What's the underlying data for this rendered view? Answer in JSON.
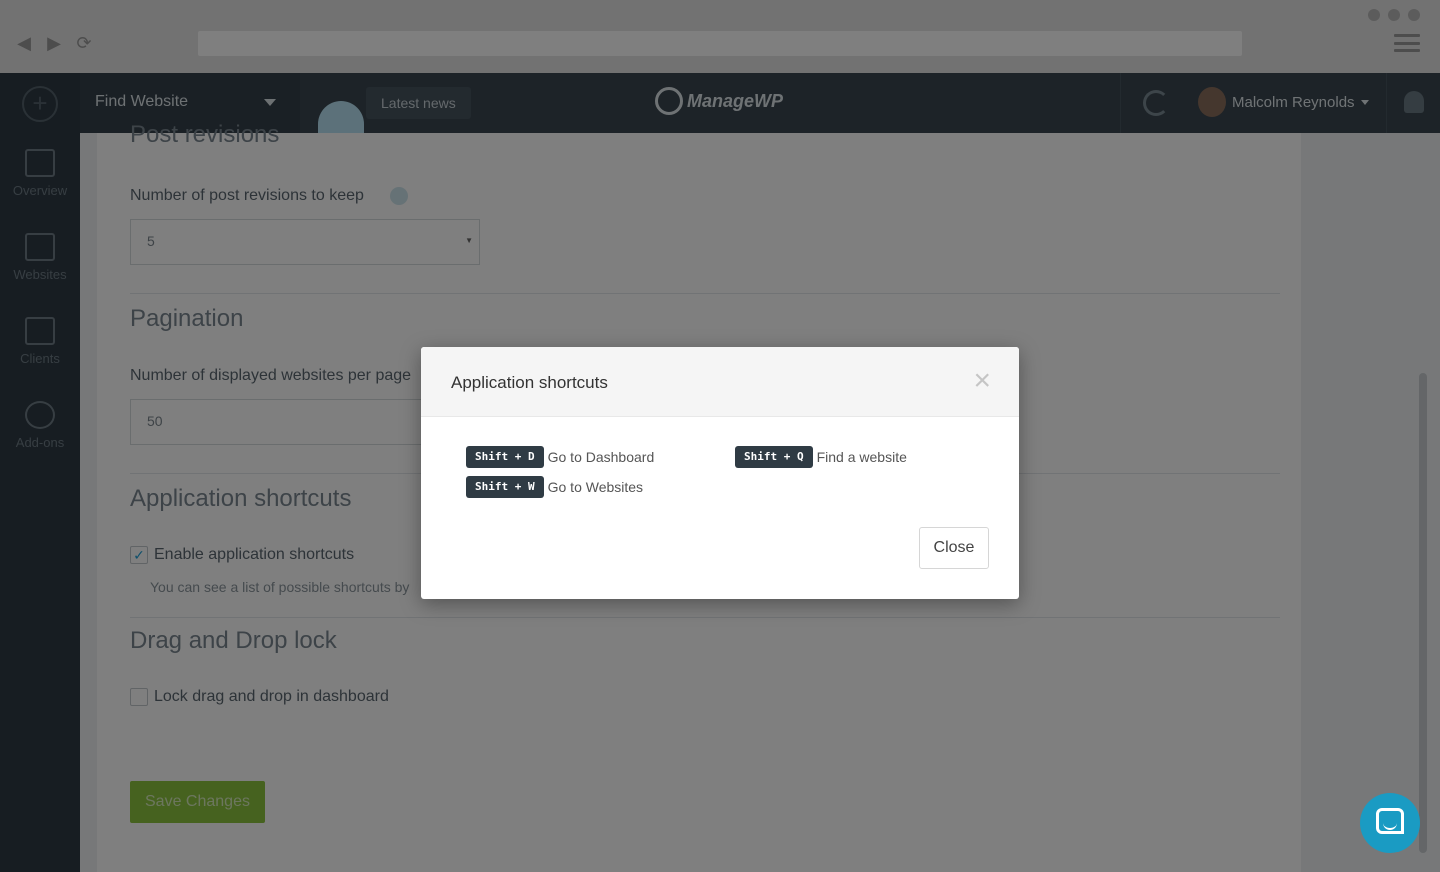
{
  "browser": {
    "back_icon": "◀",
    "forward_icon": "▶",
    "reload_icon": "⟳"
  },
  "sidebar": {
    "items": [
      {
        "label": "Overview",
        "icon": "chart-icon"
      },
      {
        "label": "Websites",
        "icon": "websites-icon"
      },
      {
        "label": "Clients",
        "icon": "clients-icon"
      },
      {
        "label": "Add-ons",
        "icon": "gear-icon"
      }
    ]
  },
  "topbar": {
    "find_label": "Find Website",
    "news_label": "Latest news",
    "logo_text": "ManageWP",
    "user_name": "Malcolm Reynolds"
  },
  "settings": {
    "post_revisions_heading": "Post revisions",
    "post_revisions_label": "Number of post revisions to keep",
    "post_revisions_value": "5",
    "pagination_heading": "Pagination",
    "pagination_label": "Number of displayed websites per page",
    "pagination_value": "50",
    "shortcuts_heading": "Application shortcuts",
    "shortcuts_checkbox_label": "Enable application shortcuts",
    "shortcuts_help": "You can see a list of possible shortcuts by",
    "dnd_heading": "Drag and Drop lock",
    "dnd_checkbox_label": "Lock drag and drop in dashboard",
    "save_label": "Save Changes"
  },
  "modal": {
    "title": "Application shortcuts",
    "close_icon": "×",
    "close_label": "Close",
    "shortcuts": [
      {
        "keys": "Shift + D",
        "action": "Go to Dashboard"
      },
      {
        "keys": "Shift + Q",
        "action": "Find a website"
      },
      {
        "keys": "Shift + W",
        "action": "Go to Websites"
      }
    ]
  },
  "colors": {
    "sidebar_bg": "#2f3b44",
    "topbar_bg": "#3a4750",
    "kbd_bg": "#2f3b44",
    "accent_green": "#8cc53f",
    "chat_blue": "#1a9bc3"
  }
}
